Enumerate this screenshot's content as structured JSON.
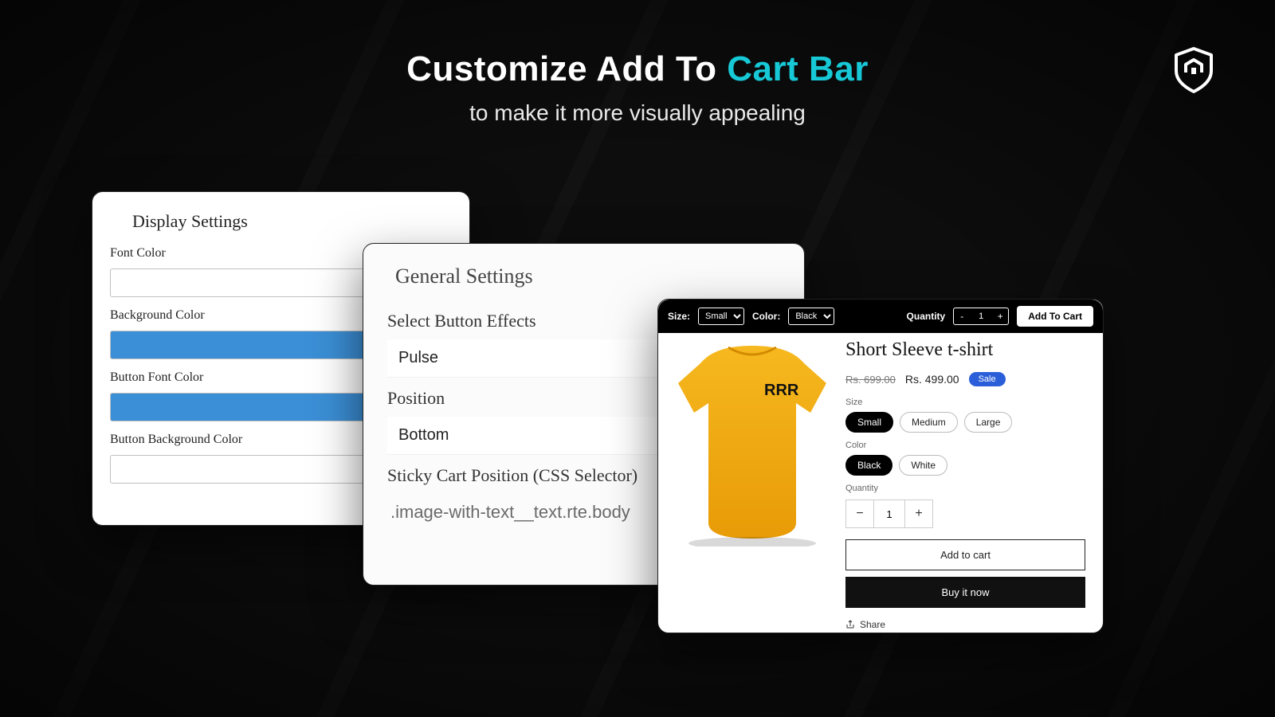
{
  "headline": {
    "prefix": "Customize Add To ",
    "accent": "Cart Bar",
    "sub": "to make it more visually appealing"
  },
  "display": {
    "title": "Display Settings",
    "font_color_label": "Font Color",
    "bg_color_label": "Background Color",
    "btn_font_color_label": "Button Font Color",
    "btn_bg_color_label": "Button Background Color",
    "colors": {
      "font": "#ffffff",
      "bg": "#3b8fd6",
      "btn_font": "#3b8fd6",
      "btn_bg": "#ffffff"
    }
  },
  "general": {
    "title": "General Settings",
    "effects_label": "Select Button Effects",
    "effects_value": "Pulse",
    "position_label": "Position",
    "position_value": "Bottom",
    "css_label": "Sticky Cart Position (CSS Selector)",
    "css_value": ".image-with-text__text.rte.body"
  },
  "sticky": {
    "size_label": "Size:",
    "size_value": "Small",
    "color_label": "Color:",
    "color_value": "Black",
    "qty_label": "Quantity",
    "qty_value": "1",
    "atc_label": "Add To Cart"
  },
  "product": {
    "title": "Short Sleeve t-shirt",
    "price_old": "Rs. 699.00",
    "price_new": "Rs. 499.00",
    "sale_label": "Sale",
    "size_label": "Size",
    "sizes": [
      "Small",
      "Medium",
      "Large"
    ],
    "size_active": "Small",
    "color_label": "Color",
    "colors": [
      "Black",
      "White"
    ],
    "color_active": "Black",
    "qty_label": "Quantity",
    "qty_value": "1",
    "add_label": "Add to cart",
    "buy_label": "Buy it now",
    "share_label": "Share",
    "shirt_text": "RRR"
  }
}
